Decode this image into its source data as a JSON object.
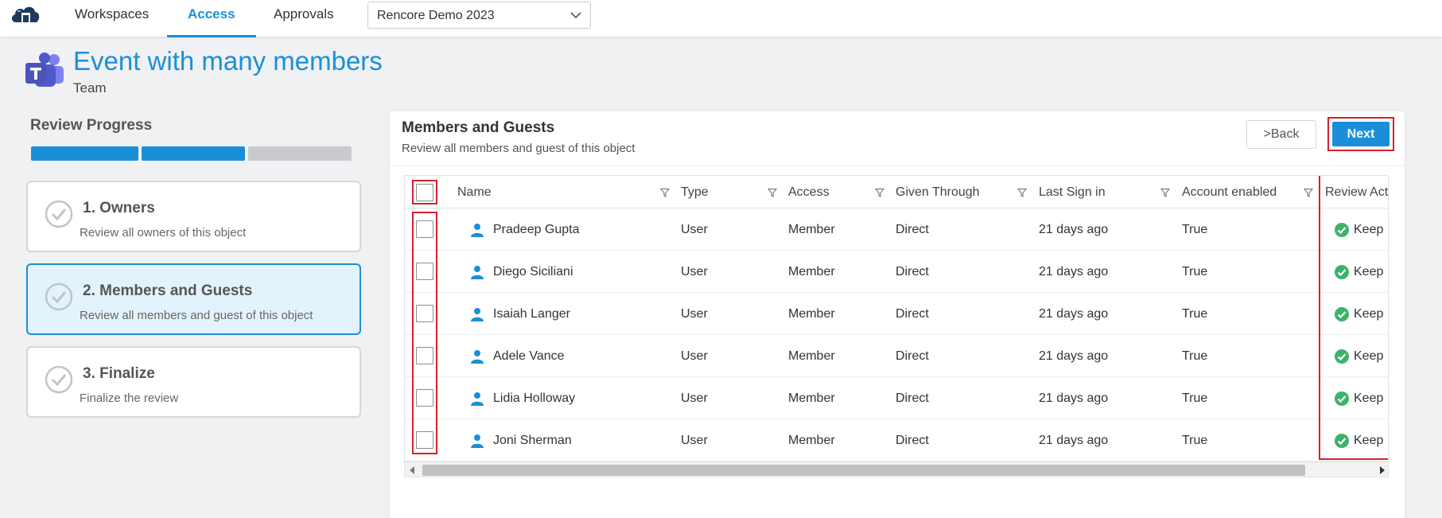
{
  "nav": {
    "logo_icon": "cloud-logo-icon",
    "items": [
      {
        "label": "Workspaces"
      },
      {
        "label": "Access"
      },
      {
        "label": "Approvals"
      }
    ],
    "active": "Access",
    "workspace_select": {
      "value": "Rencore Demo 2023"
    }
  },
  "header": {
    "icon": "teams-icon",
    "title": "Event with many members",
    "subtitle": "Team"
  },
  "progress": {
    "title": "Review Progress",
    "segments": [
      {
        "state": "complete"
      },
      {
        "state": "complete"
      },
      {
        "state": "pending"
      }
    ],
    "steps": [
      {
        "title": "1. Owners",
        "description": "Review all owners of this object",
        "active": false
      },
      {
        "title": "2. Members and Guests",
        "description": "Review all members and guest of this object",
        "active": true
      },
      {
        "title": "3. Finalize",
        "description": "Finalize the review",
        "active": false
      }
    ]
  },
  "panel": {
    "title": "Members and Guests",
    "subtitle": "Review all members and guest of this object",
    "back_label": ">Back",
    "next_label": "Next"
  },
  "table": {
    "columns": [
      {
        "label": "Name"
      },
      {
        "label": "Type"
      },
      {
        "label": "Access"
      },
      {
        "label": "Given Through"
      },
      {
        "label": "Last Sign in"
      },
      {
        "label": "Account enabled"
      },
      {
        "label": "Review Actio"
      }
    ],
    "rows": [
      {
        "name": "Pradeep Gupta",
        "type": "User",
        "access": "Member",
        "given": "Direct",
        "last_sign_in": "21 days ago",
        "enabled": "True",
        "action": "Keep"
      },
      {
        "name": "Diego Siciliani",
        "type": "User",
        "access": "Member",
        "given": "Direct",
        "last_sign_in": "21 days ago",
        "enabled": "True",
        "action": "Keep"
      },
      {
        "name": "Isaiah Langer",
        "type": "User",
        "access": "Member",
        "given": "Direct",
        "last_sign_in": "21 days ago",
        "enabled": "True",
        "action": "Keep"
      },
      {
        "name": "Adele Vance",
        "type": "User",
        "access": "Member",
        "given": "Direct",
        "last_sign_in": "21 days ago",
        "enabled": "True",
        "action": "Keep"
      },
      {
        "name": "Lidia Holloway",
        "type": "User",
        "access": "Member",
        "given": "Direct",
        "last_sign_in": "21 days ago",
        "enabled": "True",
        "action": "Keep"
      },
      {
        "name": "Joni Sherman",
        "type": "User",
        "access": "Member",
        "given": "Direct",
        "last_sign_in": "21 days ago",
        "enabled": "True",
        "action": "Keep"
      }
    ]
  },
  "colors": {
    "accent": "#1a8fd8",
    "highlight_frame": "#d8202b",
    "keep_green": "#3cb36a"
  }
}
